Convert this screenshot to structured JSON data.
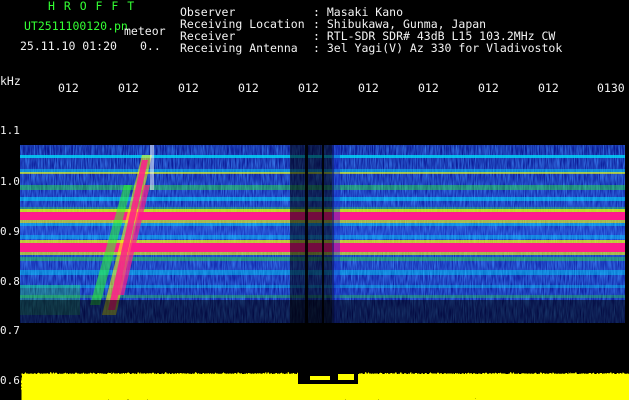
{
  "header": {
    "brand": "H R O F F T",
    "file_name": "UT2511100120.pn",
    "tag": "meteor",
    "datetime": "25.11.10 01:20",
    "extra": "0..",
    "info_labels": [
      "Observer",
      "Receiving Location",
      "Receiver",
      "Receiving Antenna"
    ],
    "info_values": [
      ": Masaki Kano",
      ": Shibukawa, Gunma, Japan",
      ": RTL-SDR SDR# 43dB L15 103.2MHz CW",
      ": 3el Yagi(V) Az 330 for Vladivostok"
    ]
  },
  "axis": {
    "unit": "kHz",
    "time_ticks": [
      "012",
      "012",
      "012",
      "012",
      "012",
      "012",
      "012",
      "012",
      "012",
      "0130"
    ],
    "freq_ticks": [
      "1.1",
      "1.0",
      "0.9",
      "0.8",
      "0.7",
      "0.6"
    ]
  },
  "colors": {
    "background": "#000000",
    "noise": "#1a2fd0",
    "cyan": "#00e5ff",
    "green": "#2bff2b",
    "yellow": "#ffff00",
    "magenta": "#ff1a8c",
    "title_green": "#33ff33"
  }
}
